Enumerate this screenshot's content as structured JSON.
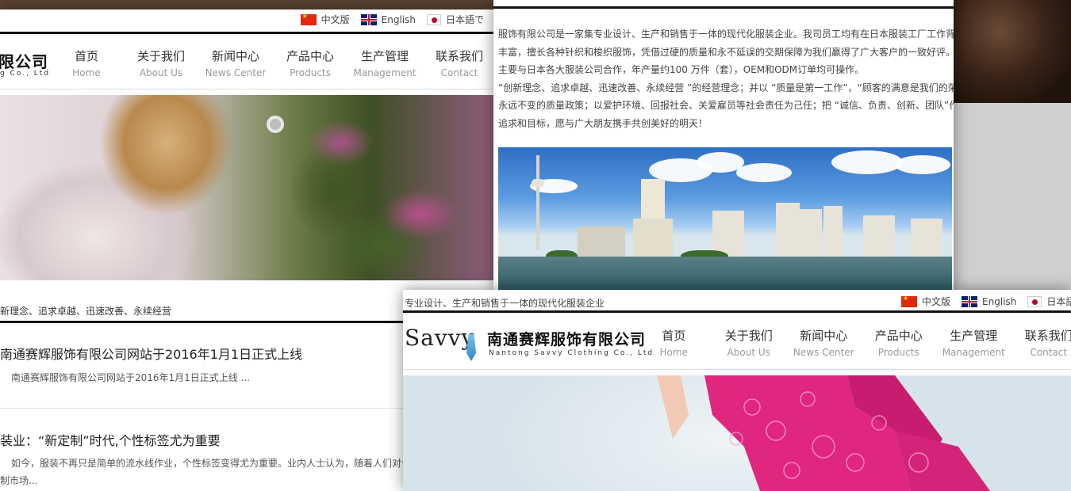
{
  "colors": {
    "accent_black": "#111111",
    "nav_en_gray": "#999999",
    "flag_red": "#de2910"
  },
  "languages": [
    {
      "flag": "china-flag-icon",
      "label": "中文版"
    },
    {
      "flag": "uk-flag-icon",
      "label": "English"
    },
    {
      "flag": "japan-flag-icon",
      "label": "日本語で"
    }
  ],
  "shotC_languages": [
    {
      "flag": "china-flag-icon",
      "label": "中文版"
    },
    {
      "flag": "uk-flag-icon",
      "label": "English"
    },
    {
      "flag": "japan-flag-icon",
      "label": "日本語で"
    }
  ],
  "nav": [
    {
      "zh": "首页",
      "en": "Home"
    },
    {
      "zh": "关于我们",
      "en": "About Us"
    },
    {
      "zh": "新闻中心",
      "en": "News Center"
    },
    {
      "zh": "产品中心",
      "en": "Products"
    },
    {
      "zh": "生产管理",
      "en": "Management"
    },
    {
      "zh": "联系我们",
      "en": "Contact"
    }
  ],
  "shotA": {
    "logo_cn": "限公司",
    "logo_en": "g Co., Ltd",
    "slogan": "新理念、追求卓越、迅速改善、永续经营",
    "news": [
      {
        "title": "南通赛辉服饰有限公司网站于2016年1月1日正式上线",
        "summary": "南通赛辉服饰有限公司网站于2016年1月1日正式上线 ..."
      },
      {
        "title": "装业：“新定制”时代,个性标签尤为重要",
        "summary_l1": "如今，服装不再只是简单的流水线作业，个性标签变得尤为重要。业内人士认为，随着人们对个性化的",
        "summary_l2": "制市场..."
      }
    ]
  },
  "shotB": {
    "paragraph_lines": [
      "服饰有限公司是一家集专业设计、生产和销售于一体的现代化服装企业。我司员工均有在日本服装工厂工作背景，技",
      "丰富，擅长各种针织和梭织服饰，凭借过硬的质量和永不延误的交期保障为我们赢得了广大客户的一致好评。",
      "主要与日本各大服装公司合作，年产量约100 万件（套），OEM和ODM订单均可操作。",
      "“创新理念、追求卓越、迅速改善、永续经营 ”的经营理念；并以 “质量是第一工作”，“顾客的满意是我们的荣",
      "永远不变的质量政策；以爱护环境、回报社会、关爱雇员等社会责任为己任；把 “诚信、负责、创新、团队”作为",
      "追求和目标，愿与广大朋友携手共创美好的明天！"
    ]
  },
  "shotC": {
    "tagline": "专业设计、生产和销售于一体的现代化服装企业",
    "logo_mark": "Savvy",
    "logo_cn": "南通赛辉服饰有限公司",
    "logo_en": "Nantong Savvy Clothing Co., Ltd"
  }
}
